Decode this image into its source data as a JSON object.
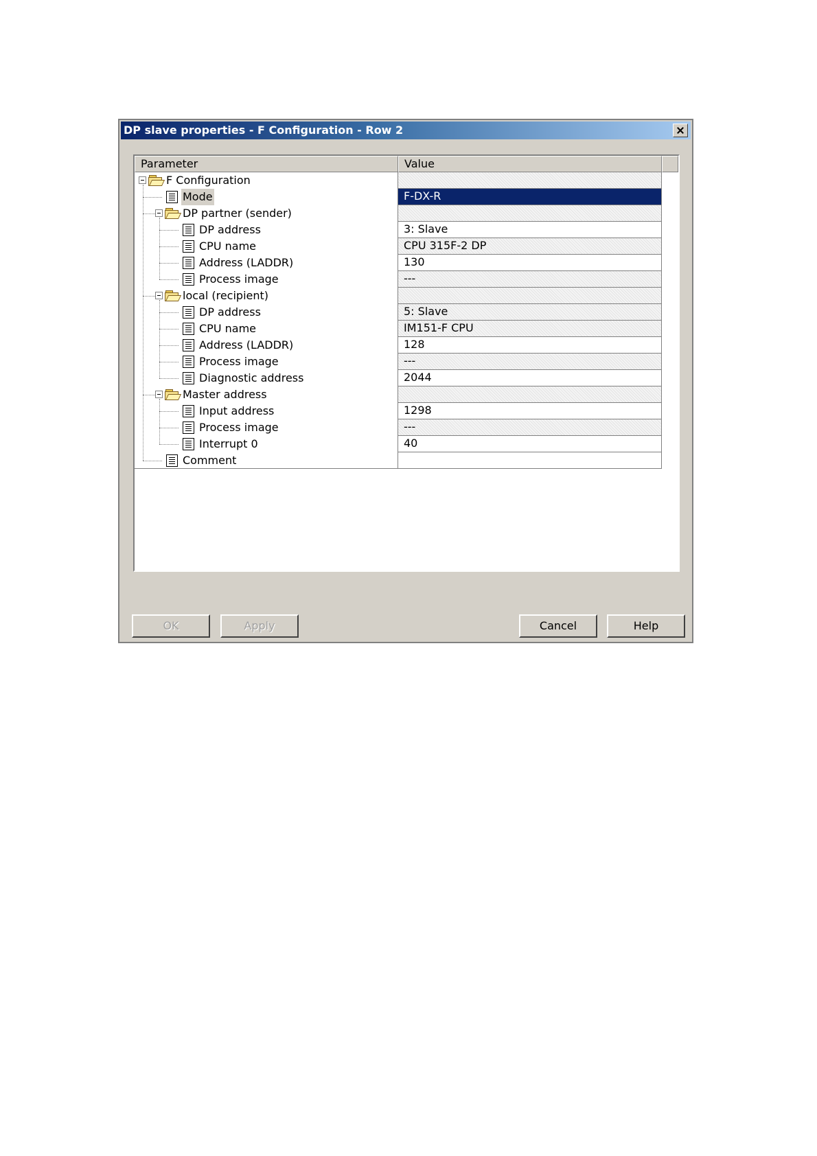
{
  "window": {
    "title": "DP slave properties - F Configuration - Row 2"
  },
  "table": {
    "headers": {
      "parameter": "Parameter",
      "value": "Value"
    },
    "rows": [
      {
        "label": "F Configuration",
        "value": "",
        "level": 0,
        "icon": "folder-icon",
        "expander": true,
        "grey": true
      },
      {
        "label": "Mode",
        "value": "F-DX-R",
        "level": 1,
        "icon": "document-icon",
        "selected": true
      },
      {
        "label": "DP partner (sender)",
        "value": "",
        "level": 1,
        "icon": "folder-icon",
        "expander": true,
        "grey": true
      },
      {
        "label": "DP address",
        "value": "3: Slave",
        "level": 2,
        "icon": "document-icon"
      },
      {
        "label": "CPU name",
        "value": "CPU 315F-2 DP",
        "level": 2,
        "icon": "document-icon",
        "grey": true
      },
      {
        "label": "Address (LADDR)",
        "value": "130",
        "level": 2,
        "icon": "document-icon"
      },
      {
        "label": "Process image",
        "value": "---",
        "level": 2,
        "icon": "document-icon",
        "grey": true
      },
      {
        "label": "local (recipient)",
        "value": "",
        "level": 1,
        "icon": "folder-icon",
        "expander": true,
        "grey": true
      },
      {
        "label": "DP address",
        "value": "5: Slave",
        "level": 2,
        "icon": "document-icon",
        "grey": true
      },
      {
        "label": "CPU name",
        "value": "IM151-F CPU",
        "level": 2,
        "icon": "document-icon",
        "grey": true
      },
      {
        "label": "Address (LADDR)",
        "value": "128",
        "level": 2,
        "icon": "document-icon"
      },
      {
        "label": "Process image",
        "value": "---",
        "level": 2,
        "icon": "document-icon",
        "grey": true
      },
      {
        "label": "Diagnostic address",
        "value": "2044",
        "level": 2,
        "icon": "document-icon"
      },
      {
        "label": "Master address",
        "value": "",
        "level": 1,
        "icon": "folder-icon",
        "expander": true,
        "grey": true
      },
      {
        "label": "Input address",
        "value": "1298",
        "level": 2,
        "icon": "document-icon"
      },
      {
        "label": "Process image",
        "value": "---",
        "level": 2,
        "icon": "document-icon",
        "grey": true
      },
      {
        "label": "Interrupt 0",
        "value": "40",
        "level": 2,
        "icon": "document-icon"
      },
      {
        "label": "Comment",
        "value": "",
        "level": 1,
        "icon": "document-icon"
      }
    ]
  },
  "buttons": {
    "ok": "OK",
    "apply": "Apply",
    "cancel": "Cancel",
    "help": "Help"
  }
}
